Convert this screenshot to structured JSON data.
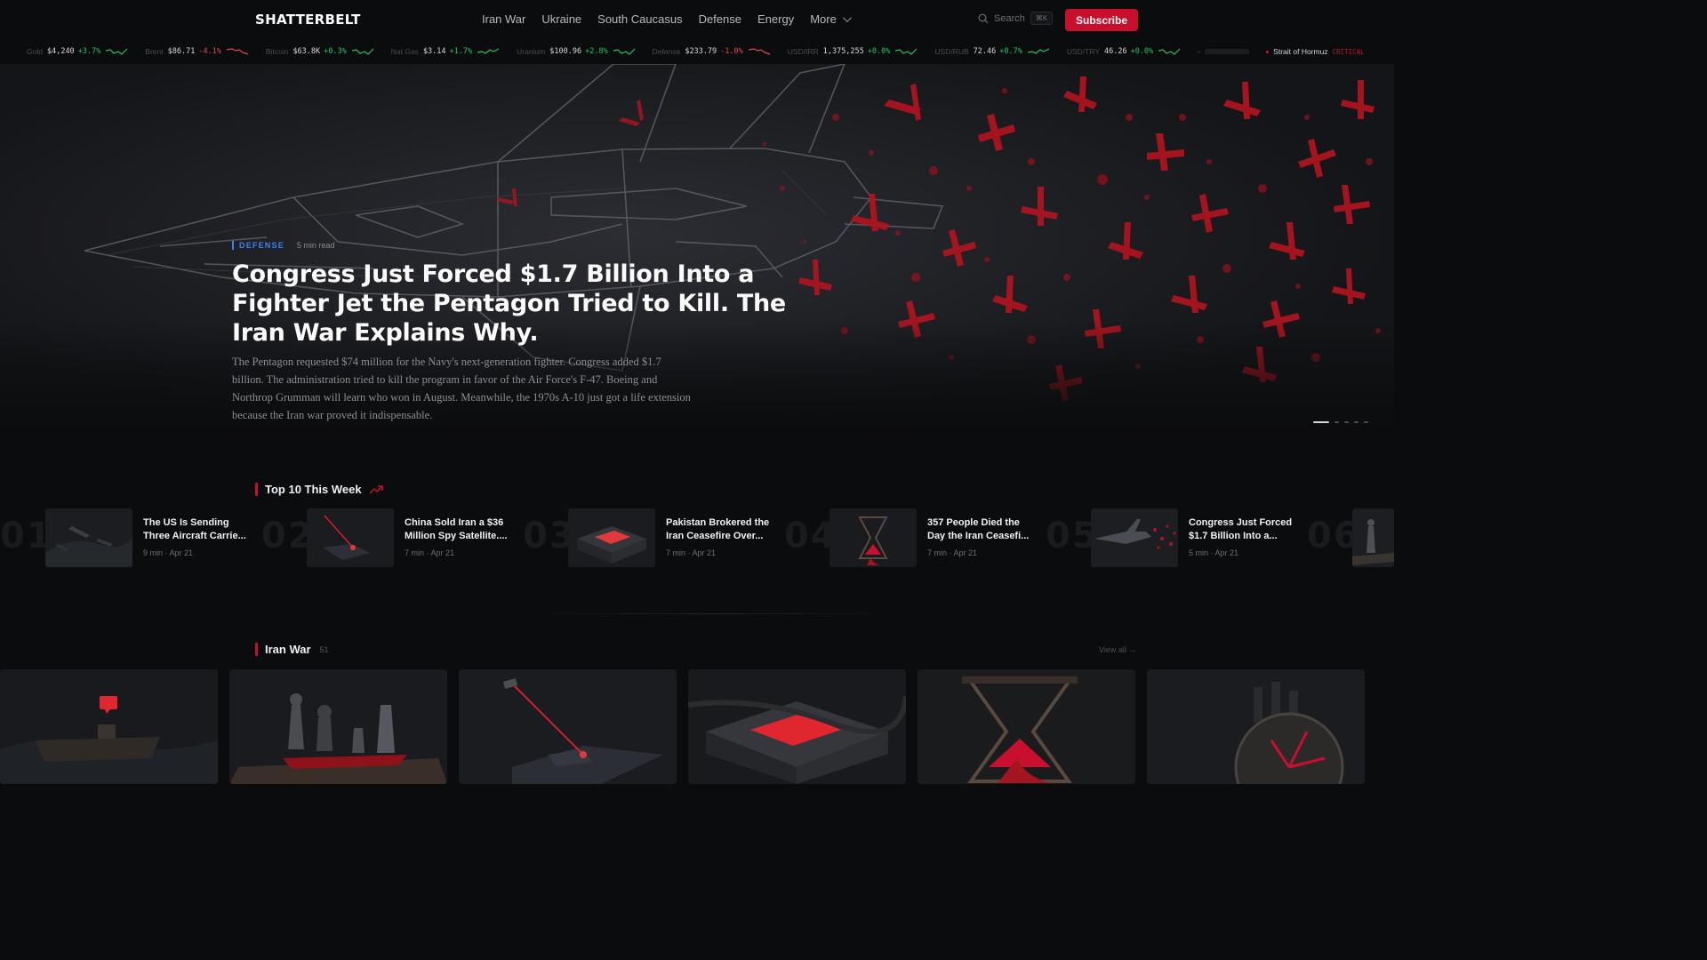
{
  "header": {
    "logo": "SHATTERBELT",
    "nav": [
      "Iran War",
      "Ukraine",
      "South Caucasus",
      "Defense",
      "Energy"
    ],
    "more_label": "More",
    "search_label": "Search",
    "search_shortcut": "⌘K",
    "subscribe_label": "Subscribe"
  },
  "ticker": [
    {
      "label": "Gold",
      "value": "$4,240",
      "change": "+3.7%",
      "dir": "up"
    },
    {
      "label": "Brent",
      "value": "$86.71",
      "change": "-4.1%",
      "dir": "down"
    },
    {
      "label": "Bitcoin",
      "value": "$63.8K",
      "change": "+0.3%",
      "dir": "up"
    },
    {
      "label": "Nat Gas",
      "value": "$3.14",
      "change": "+1.7%",
      "dir": "up"
    },
    {
      "label": "Uranium",
      "value": "$100.96",
      "change": "+2.8%",
      "dir": "up"
    },
    {
      "label": "Defense",
      "value": "$233.79",
      "change": "-1.0%",
      "dir": "down"
    },
    {
      "label": "USD/IRR",
      "value": "1,375,255",
      "change": "+0.0%",
      "dir": "up"
    },
    {
      "label": "USD/RUB",
      "value": "72.46",
      "change": "+0.7%",
      "dir": "up"
    },
    {
      "label": "USD/TRY",
      "value": "46.26",
      "change": "+0.0%",
      "dir": "up"
    }
  ],
  "alerts": [
    {
      "label": "Strait of Hormuz",
      "status": "CRITICAL"
    }
  ],
  "hero": {
    "category": "DEFENSE",
    "read_time": "5 min read",
    "title": "Congress Just Forced $1.7 Billion Into a Fighter Jet the Pentagon Tried to Kill. The Iran War Explains Why.",
    "description": "The Pentagon requested $74 million for the Navy's next-generation fighter. Congress added $1.7 billion. The administration tried to kill the program in favor of the Air Force's F-47. Boeing and Northrop Grumman will learn who won in August. Meanwhile, the 1970s A-10 just got a life extension because the Iran war proved it indispensable.",
    "slide_count": 5,
    "active_slide": 1
  },
  "top10": {
    "title": "Top 10 This Week",
    "items": [
      {
        "rank": "01",
        "title": "The US Is Sending Three Aircraft Carrie...",
        "meta": "9 min · Apr 21"
      },
      {
        "rank": "02",
        "title": "China Sold Iran a $36 Million Spy Satellite....",
        "meta": "7 min · Apr 21"
      },
      {
        "rank": "03",
        "title": "Pakistan Brokered the Iran Ceasefire Over...",
        "meta": "7 min · Apr 21"
      },
      {
        "rank": "04",
        "title": "357 People Died the Day the Iran Ceasefi...",
        "meta": "7 min · Apr 21"
      },
      {
        "rank": "05",
        "title": "Congress Just Forced $1.7 Billion Into a...",
        "meta": "5 min · Apr 21"
      },
      {
        "rank": "06",
        "title": "",
        "meta": ""
      }
    ]
  },
  "iran_war": {
    "title": "Iran War",
    "count": "51",
    "view_all": "View all →"
  }
}
